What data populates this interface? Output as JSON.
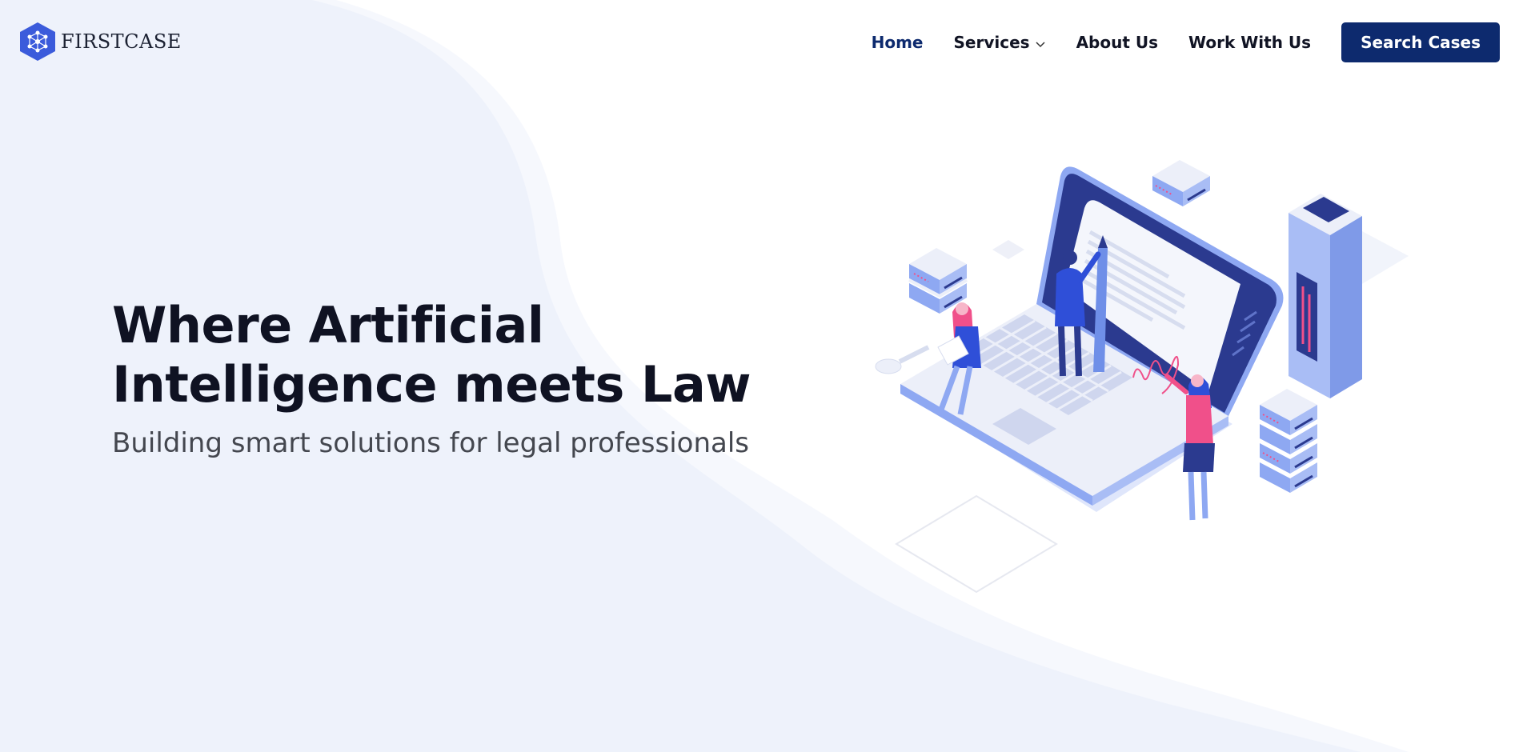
{
  "brand": {
    "logo_icon": "hexagon-network-icon",
    "name_part1": "FIRST",
    "name_part2": "CASE",
    "accent": "#3b5bdb"
  },
  "nav": {
    "items": [
      {
        "label": "Home",
        "active": true
      },
      {
        "label": "Services",
        "has_dropdown": true,
        "icon": "chevron-down-icon"
      },
      {
        "label": "About Us"
      },
      {
        "label": "Work With Us"
      }
    ],
    "cta_label": "Search Cases",
    "cta_color": "#0d2a6e"
  },
  "hero": {
    "title_line1": "Where Artificial",
    "title_line2": "Intelligence meets Law",
    "subtitle": "Building smart solutions for legal professionals"
  },
  "illustration": {
    "icon": "isometric-laptop-legal-signing-illustration",
    "signature_text": "Mf"
  },
  "colors": {
    "background_wave": "#eef2fb",
    "heading": "#0f1222",
    "subtitle": "#44474f",
    "illustration_primary": "#2b3a8f",
    "illustration_light": "#8ea8f2",
    "illustration_pink": "#f0508a"
  }
}
